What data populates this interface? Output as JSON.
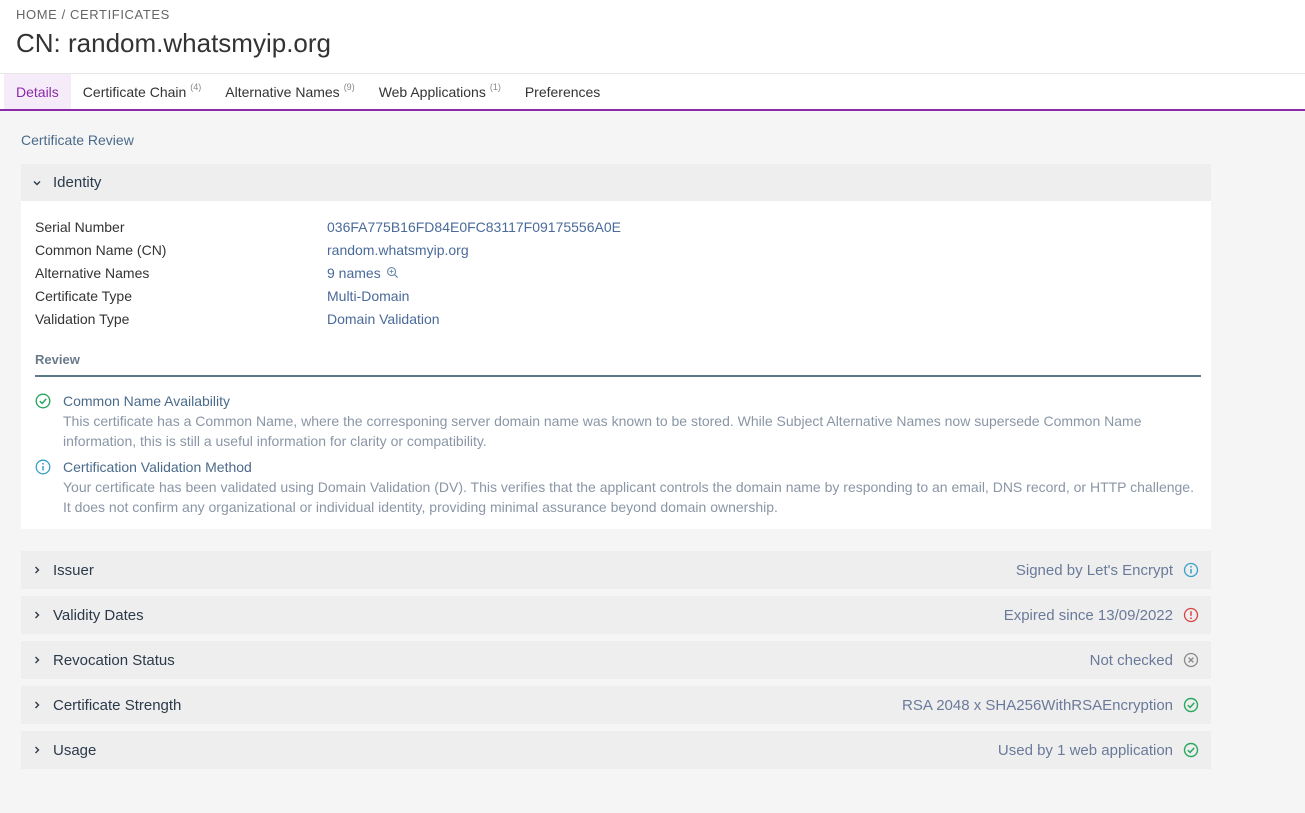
{
  "header": {
    "breadcrumb": "HOME / CERTIFICATES",
    "title": "CN: random.whatsmyip.org"
  },
  "tabs": [
    {
      "label": "Details",
      "count": ""
    },
    {
      "label": "Certificate Chain",
      "count": "(4)"
    },
    {
      "label": "Alternative Names",
      "count": "(9)"
    },
    {
      "label": "Web Applications",
      "count": "(1)"
    },
    {
      "label": "Preferences",
      "count": ""
    }
  ],
  "main": {
    "section_title": "Certificate Review",
    "identity": {
      "title": "Identity",
      "rows": [
        {
          "key": "Serial Number",
          "value": "036FA775B16FD84E0FC83117F09175556A0E"
        },
        {
          "key": "Common Name (CN)",
          "value": "random.whatsmyip.org"
        },
        {
          "key": "Alternative Names",
          "value": "9 names"
        },
        {
          "key": "Certificate Type",
          "value": "Multi-Domain"
        },
        {
          "key": "Validation Type",
          "value": "Domain Validation"
        }
      ],
      "review_title": "Review",
      "review": [
        {
          "title": "Common Name Availability",
          "text": "This certificate has a Common Name, where the corresponing server domain name was known to be stored. While Subject Alternative Names now supersede Common Name information, this is still a useful information for clarity or compatibility.",
          "icon": "check-circle-icon"
        },
        {
          "title": "Certification Validation Method",
          "text": "Your certificate has been validated using Domain Validation (DV). This verifies that the applicant controls the domain name by responding to an email, DNS record, or HTTP challenge. It does not confirm any organizational or individual identity, providing minimal assurance beyond domain ownership.",
          "icon": "info-circle-icon"
        }
      ]
    },
    "sections": [
      {
        "label": "Issuer",
        "status": "Signed by Let's Encrypt",
        "icon": "info-circle-icon",
        "color": "#3aa0c8"
      },
      {
        "label": "Validity Dates",
        "status": "Expired since 13/09/2022",
        "icon": "alert-circle-icon",
        "color": "#d64545"
      },
      {
        "label": "Revocation Status",
        "status": "Not checked",
        "icon": "x-circle-icon",
        "color": "#8a8a8a"
      },
      {
        "label": "Certificate Strength",
        "status": "RSA 2048 x SHA256WithRSAEncryption",
        "icon": "check-circle-icon",
        "color": "#2aa860"
      },
      {
        "label": "Usage",
        "status": "Used by 1 web application",
        "icon": "check-circle-icon",
        "color": "#2aa860"
      }
    ]
  },
  "colors": {
    "accent": "#8a2aa8",
    "success": "#2aa860",
    "info": "#3aa0c8",
    "danger": "#d64545"
  }
}
